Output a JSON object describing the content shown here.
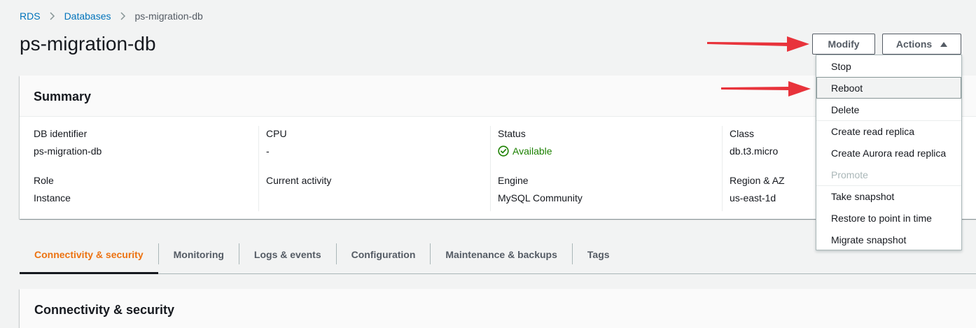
{
  "breadcrumb": {
    "items": [
      "RDS",
      "Databases"
    ],
    "current": "ps-migration-db"
  },
  "page": {
    "title": "ps-migration-db"
  },
  "header_buttons": {
    "modify": "Modify",
    "actions": "Actions"
  },
  "summary": {
    "title": "Summary",
    "fields": {
      "db_identifier": {
        "label": "DB identifier",
        "value": "ps-migration-db"
      },
      "cpu": {
        "label": "CPU",
        "value": "-"
      },
      "status": {
        "label": "Status",
        "value": "Available"
      },
      "class": {
        "label": "Class",
        "value": "db.t3.micro"
      },
      "role": {
        "label": "Role",
        "value": "Instance"
      },
      "current_activity": {
        "label": "Current activity",
        "value": ""
      },
      "engine": {
        "label": "Engine",
        "value": "MySQL Community"
      },
      "region": {
        "label": "Region & AZ",
        "value": "us-east-1d"
      }
    }
  },
  "tabs": [
    "Connectivity & security",
    "Monitoring",
    "Logs & events",
    "Configuration",
    "Maintenance & backups",
    "Tags"
  ],
  "active_tab": "Connectivity & security",
  "connectivity_panel": {
    "title": "Connectivity & security"
  },
  "actions_menu": {
    "items": [
      "Stop",
      "Reboot",
      "Delete",
      "Create read replica",
      "Create Aurora read replica",
      "Promote",
      "Take snapshot",
      "Restore to point in time",
      "Migrate snapshot"
    ],
    "highlighted": "Reboot",
    "disabled": [
      "Promote"
    ]
  },
  "colors": {
    "link": "#0073bb",
    "active_tab": "#ec7211",
    "status_available": "#1d8102",
    "annotation_arrow": "#e8333b"
  },
  "icons": {
    "status": "check-circle-icon",
    "separator": "chevron-right-icon",
    "actions": "caret-up-icon",
    "annotation": "red-arrow-icon"
  }
}
